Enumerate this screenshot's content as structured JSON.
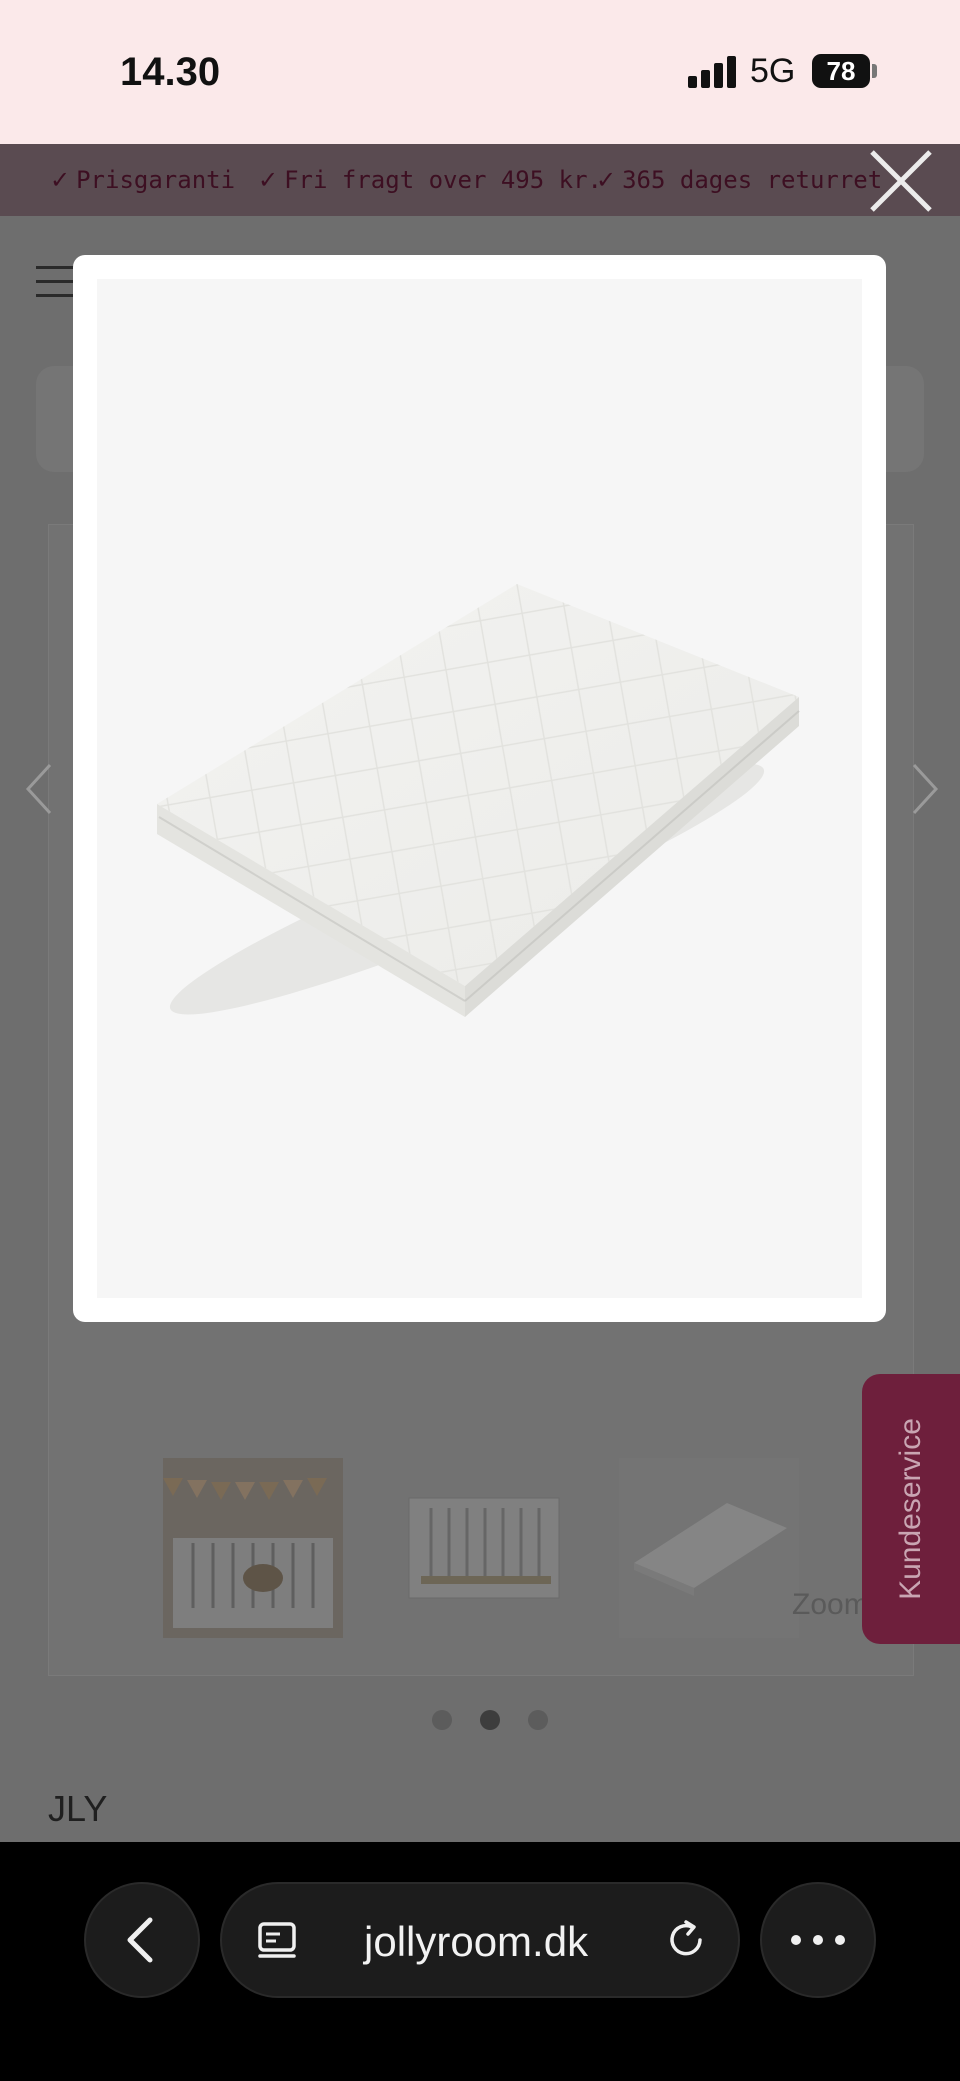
{
  "status_bar": {
    "time": "14.30",
    "network": "5G",
    "battery": "78"
  },
  "promo": [
    {
      "check": "✓",
      "text": "Prisgaranti"
    },
    {
      "check": "✓",
      "text": "Fri fragt over 495 kr."
    },
    {
      "check": "✓",
      "text": "365 dages returret"
    }
  ],
  "page": {
    "brand": "JLY",
    "zoom_hint": "Zoom",
    "gallery_dots": {
      "count": 3,
      "active_index": 1
    }
  },
  "customer_service": {
    "label": "Kundeservice"
  },
  "modal": {
    "image_alt": "baby mattress"
  },
  "browser": {
    "url": "jollyroom.dk"
  },
  "icons": [
    "close-icon",
    "chevron-left-icon",
    "chevron-right-icon",
    "back-icon",
    "tabs-icon",
    "reload-icon",
    "more-icon",
    "signal-icon",
    "battery-icon",
    "check-icon",
    "menu-icon"
  ]
}
